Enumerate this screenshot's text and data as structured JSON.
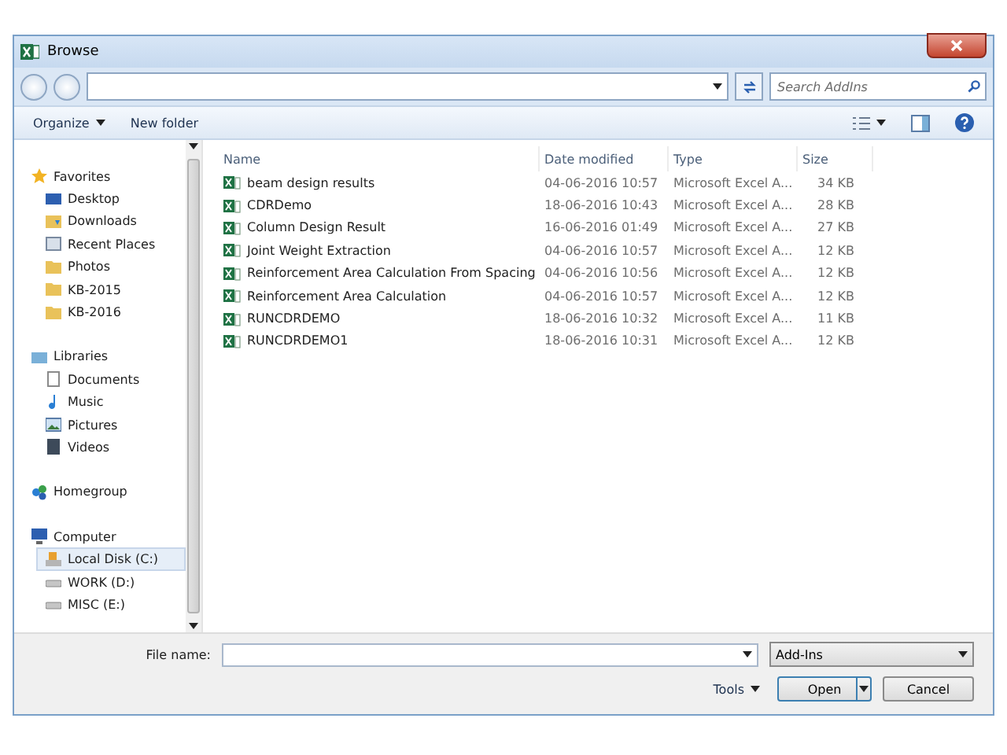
{
  "window": {
    "title": "Browse"
  },
  "address": {
    "search_placeholder": "Search AddIns"
  },
  "toolbar": {
    "organize": "Organize",
    "new_folder": "New folder"
  },
  "sidebar": {
    "groups": [
      {
        "label": "Favorites",
        "kind": "star",
        "items": [
          {
            "label": "Desktop",
            "kind": "desktop",
            "selected": false
          },
          {
            "label": "Downloads",
            "kind": "download",
            "selected": false
          },
          {
            "label": "Recent Places",
            "kind": "recent",
            "selected": false
          },
          {
            "label": "Photos",
            "kind": "folder",
            "selected": false
          },
          {
            "label": "KB-2015",
            "kind": "folder",
            "selected": false
          },
          {
            "label": "KB-2016",
            "kind": "folder",
            "selected": false
          }
        ]
      },
      {
        "label": "Libraries",
        "kind": "library",
        "items": [
          {
            "label": "Documents",
            "kind": "document",
            "selected": false
          },
          {
            "label": "Music",
            "kind": "music",
            "selected": false
          },
          {
            "label": "Pictures",
            "kind": "picture",
            "selected": false
          },
          {
            "label": "Videos",
            "kind": "video",
            "selected": false
          }
        ]
      },
      {
        "label": "Homegroup",
        "kind": "homegroup"
      },
      {
        "label": "Computer",
        "kind": "computer",
        "items": [
          {
            "label": "Local Disk (C:)",
            "kind": "windrive",
            "selected": true
          },
          {
            "label": "WORK (D:)",
            "kind": "drive",
            "selected": false
          },
          {
            "label": "MISC (E:)",
            "kind": "drive",
            "selected": false
          }
        ]
      }
    ]
  },
  "table": {
    "columns": [
      "Name",
      "Date modified",
      "Type",
      "Size"
    ],
    "rows": [
      {
        "name": "beam design results",
        "date": "04-06-2016 10:57",
        "type": "Microsoft Excel A...",
        "size": "34 KB"
      },
      {
        "name": "CDRDemo",
        "date": "18-06-2016 10:43",
        "type": "Microsoft Excel A...",
        "size": "28 KB"
      },
      {
        "name": "Column Design Result",
        "date": "16-06-2016 01:49",
        "type": "Microsoft Excel A...",
        "size": "27 KB"
      },
      {
        "name": "Joint Weight Extraction",
        "date": "04-06-2016 10:57",
        "type": "Microsoft Excel A...",
        "size": "12 KB"
      },
      {
        "name": "Reinforcement Area Calculation From Spacing",
        "date": "04-06-2016 10:56",
        "type": "Microsoft Excel A...",
        "size": "12 KB"
      },
      {
        "name": "Reinforcement Area Calculation",
        "date": "04-06-2016 10:57",
        "type": "Microsoft Excel A...",
        "size": "12 KB"
      },
      {
        "name": "RUNCDRDEMO",
        "date": "18-06-2016 10:32",
        "type": "Microsoft Excel A...",
        "size": "11 KB"
      },
      {
        "name": "RUNCDRDEMO1",
        "date": "18-06-2016 10:31",
        "type": "Microsoft Excel A...",
        "size": "12 KB"
      }
    ]
  },
  "footer": {
    "file_name_label": "File name:",
    "filter": "Add-Ins",
    "tools": "Tools",
    "open": "Open",
    "cancel": "Cancel"
  }
}
